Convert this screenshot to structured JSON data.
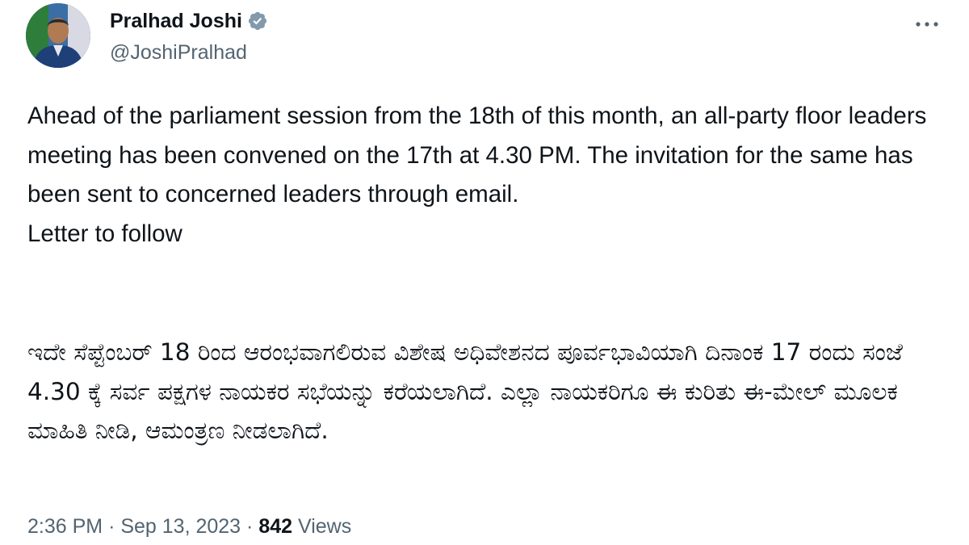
{
  "author": {
    "display_name": "Pralhad Joshi",
    "handle": "@JoshiPralhad",
    "verified_icon": "verified-badge-icon",
    "verified_color": "#829aab"
  },
  "tweet": {
    "english_paragraph": "Ahead of the parliament session from the 18th of this month, an all-party floor leaders meeting has been convened on the 17th at 4.30 PM. The invitation for the same has been sent to concerned leaders through email.",
    "english_followup": "Letter to follow",
    "kannada_paragraph": "ಇದೇ ಸೆಪ್ಟೆಂಬರ್ 18 ರಿಂದ ಆರಂಭವಾಗಲಿರುವ ವಿಶೇಷ ಅಧಿವೇಶನದ ಪೂರ್ವಭಾವಿಯಾಗಿ ದಿನಾಂಕ 17 ರಂದು ಸಂಜೆ 4.30 ಕ್ಕೆ ಸರ್ವ ಪಕ್ಷಗಳ ನಾಯಕರ ಸಭೆಯನ್ನು ಕರೆಯಲಾಗಿದೆ. ಎಲ್ಲಾ ನಾಯಕರಿಗೂ ಈ ಕುರಿತು ಈ-ಮೇಲ್ ಮೂಲಕ ಮಾಹಿತಿ ನೀಡಿ, ಆಮಂತ್ರಣ ನೀಡಲಾಗಿದೆ."
  },
  "meta": {
    "time": "2:36 PM",
    "separator": "·",
    "date": "Sep 13, 2023",
    "views_count": "842",
    "views_label": "Views"
  },
  "colors": {
    "text_primary": "#0f1419",
    "text_secondary": "#536471",
    "background": "#ffffff"
  }
}
